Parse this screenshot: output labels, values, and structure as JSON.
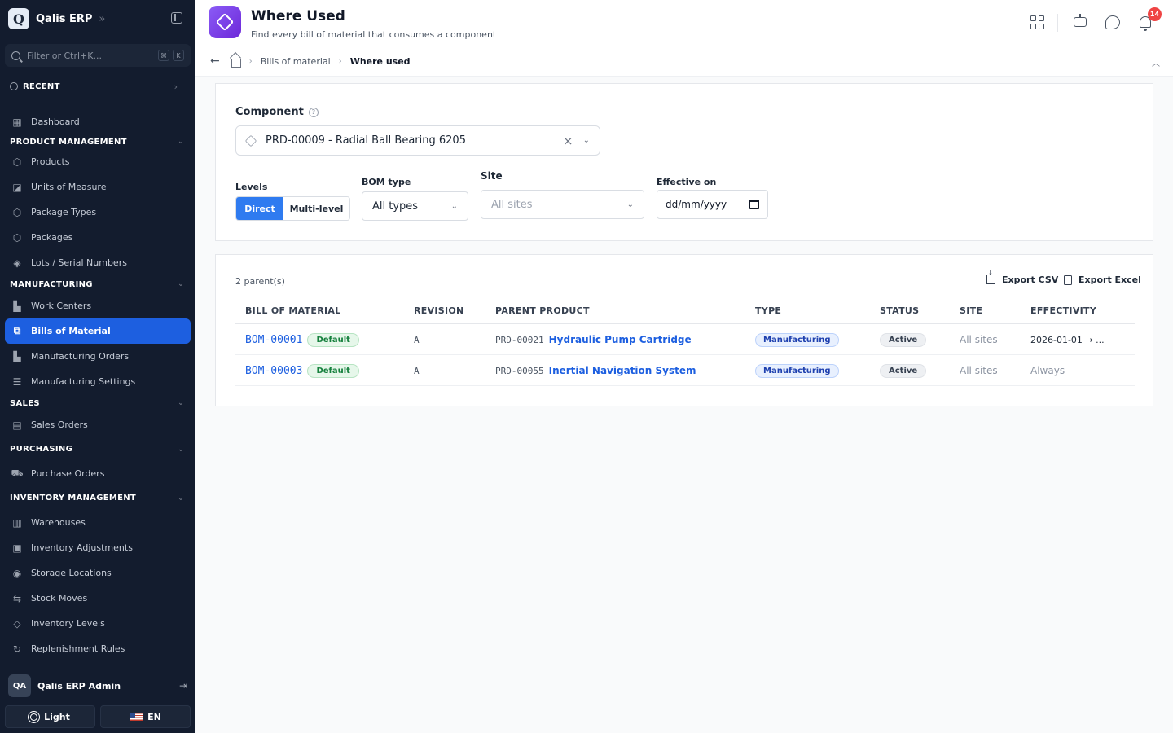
{
  "app": {
    "name": "Qalis ERP"
  },
  "search": {
    "placeholder": "Filter or Ctrl+K...",
    "kbd1": "⌘",
    "kbd2": "K"
  },
  "recent": {
    "label": "RECENT"
  },
  "nav": {
    "dashboard": "Dashboard",
    "sections": {
      "product": "PRODUCT MANAGEMENT",
      "manufacturing": "MANUFACTURING",
      "sales": "SALES",
      "purchasing": "PURCHASING",
      "inventory": "INVENTORY MANAGEMENT"
    },
    "items": {
      "products": "Products",
      "uom": "Units of Measure",
      "package_types": "Package Types",
      "packages": "Packages",
      "lots": "Lots / Serial Numbers",
      "work_centers": "Work Centers",
      "bom": "Bills of Material",
      "mfg_orders": "Manufacturing Orders",
      "mfg_settings": "Manufacturing Settings",
      "sales_orders": "Sales Orders",
      "purchase_orders": "Purchase Orders",
      "warehouses": "Warehouses",
      "inv_adjust": "Inventory Adjustments",
      "storage": "Storage Locations",
      "stock_moves": "Stock Moves",
      "inv_levels": "Inventory Levels",
      "replenish": "Replenishment Rules"
    }
  },
  "user": {
    "initials": "QA",
    "name": "Qalis ERP Admin"
  },
  "footer": {
    "theme": "Light",
    "lang": "EN"
  },
  "header": {
    "title": "Where Used",
    "subtitle": "Find every bill of material that consumes a component",
    "notifications": "14"
  },
  "breadcrumb": {
    "parent": "Bills of material",
    "current": "Where used"
  },
  "filters": {
    "component_label": "Component",
    "component_value": "PRD-00009 - Radial Ball Bearing 6205",
    "levels_label": "Levels",
    "levels_direct": "Direct",
    "levels_multi": "Multi-level",
    "bom_type_label": "BOM type",
    "bom_type_value": "All types",
    "site_label": "Site",
    "site_placeholder": "All sites",
    "effective_label": "Effective on",
    "effective_placeholder": "dd/mm/yyyy"
  },
  "results": {
    "count": "2 parent(s)",
    "export_csv": "Export CSV",
    "export_excel": "Export Excel",
    "columns": [
      "BILL OF MATERIAL",
      "REVISION",
      "PARENT PRODUCT",
      "TYPE",
      "STATUS",
      "SITE",
      "EFFECTIVITY"
    ],
    "rows": [
      {
        "bom": "BOM-00001",
        "default": "Default",
        "revision": "A",
        "product_code": "PRD-00021",
        "product_name": "Hydraulic Pump Cartridge",
        "type": "Manufacturing",
        "status": "Active",
        "site": "All sites",
        "effectivity": "2026-01-01 → ..."
      },
      {
        "bom": "BOM-00003",
        "default": "Default",
        "revision": "A",
        "product_code": "PRD-00055",
        "product_name": "Inertial Navigation System",
        "type": "Manufacturing",
        "status": "Active",
        "site": "All sites",
        "effectivity": "Always"
      }
    ]
  },
  "colors": {
    "sidebar_bg": "#131c2e",
    "accent": "#1d5fe0",
    "brand_purple": "#7c3aed",
    "badge_red": "#ef4444"
  }
}
